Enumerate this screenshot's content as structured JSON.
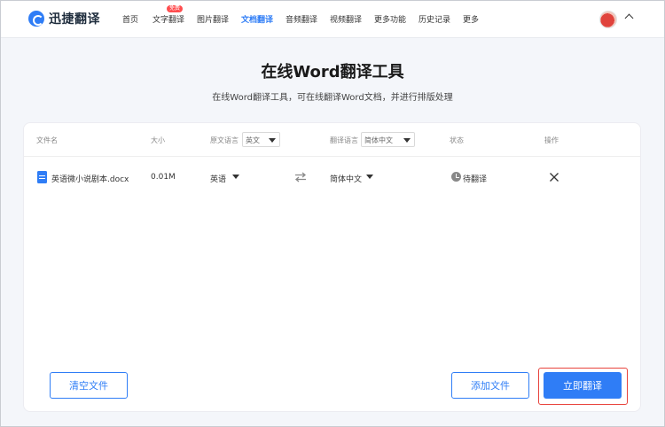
{
  "app": {
    "name": "迅捷翻译"
  },
  "nav": {
    "items": [
      {
        "label": "首页"
      },
      {
        "label": "文字翻译"
      },
      {
        "label": "图片翻译"
      },
      {
        "label": "文档翻译"
      },
      {
        "label": "音频翻译"
      },
      {
        "label": "视频翻译"
      },
      {
        "label": "更多功能"
      },
      {
        "label": "历史记录"
      },
      {
        "label": "更多"
      }
    ],
    "active": "文档翻译",
    "badge": "免费"
  },
  "hero": {
    "title": "在线Word翻译工具",
    "subtitle": "在线Word翻译工具，可在线翻译Word文档，并进行排版处理"
  },
  "table": {
    "headers": {
      "filename": "文件名",
      "size": "大小",
      "source_lang": "原文语言",
      "target_lang": "翻译语言",
      "status": "状态",
      "action": "操作"
    },
    "source_select": "英文",
    "target_select": "简体中文",
    "rows": [
      {
        "filename": "英语微小说剧本.docx",
        "size": "0.01M",
        "source": "英语",
        "target": "简体中文",
        "status": "待翻译"
      }
    ]
  },
  "buttons": {
    "clear": "清空文件",
    "add": "添加文件",
    "translate": "立即翻译"
  },
  "colors": {
    "accent": "#2f7df6",
    "highlight": "#e8433c",
    "badge": "#ff4d4f"
  }
}
